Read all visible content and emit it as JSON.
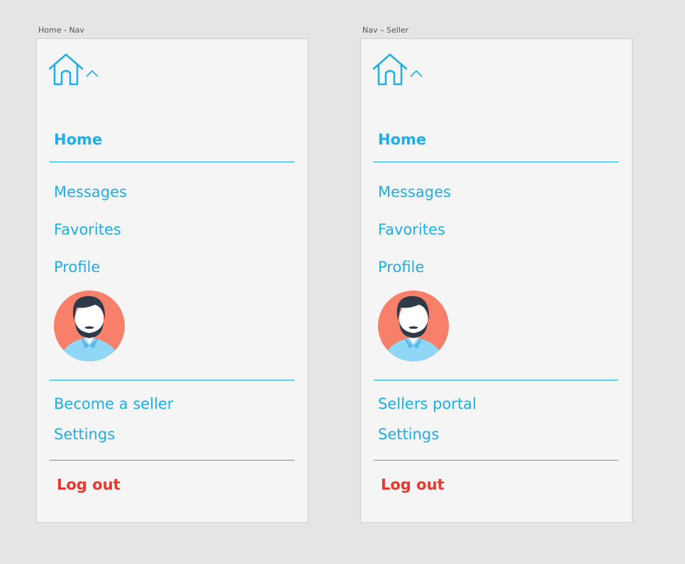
{
  "frames": [
    {
      "artboard_label": "Home - Nav",
      "nav": {
        "home": "Home",
        "messages": "Messages",
        "favorites": "Favorites",
        "profile": "Profile",
        "seller_link": "Become a seller",
        "settings": "Settings",
        "logout": "Log out"
      }
    },
    {
      "artboard_label": "Nav – Seller",
      "nav": {
        "home": "Home",
        "messages": "Messages",
        "favorites": "Favorites",
        "profile": "Profile",
        "seller_link": "Sellers portal",
        "settings": "Settings",
        "logout": "Log out"
      }
    }
  ],
  "colors": {
    "accent": "#1eaee9",
    "logout": "#e8382e",
    "avatar_background": "#f8806a",
    "panel_background": "#f5f5f5",
    "canvas_background": "#e5e5e5"
  },
  "icons": {
    "logo": "home-icon",
    "toggle": "chevron-up-icon",
    "profile_picture": "avatar"
  }
}
